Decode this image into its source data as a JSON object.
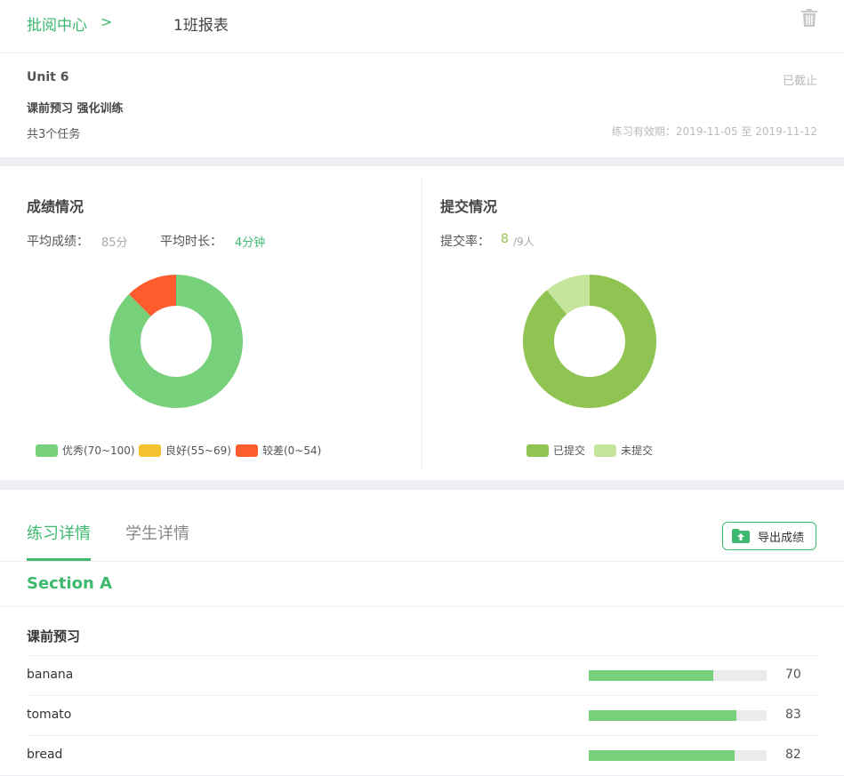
{
  "header": {
    "breadcrumb": "批阅中心",
    "separator": ">",
    "title": "1班报表"
  },
  "info": {
    "unit": "Unit 6",
    "status": "已截止",
    "task_name": "课前预习 强化训练",
    "task_count": "共3个任务",
    "validity": "练习有效期：2019-11-05 至 2019-11-12"
  },
  "scores": {
    "title": "成绩情况",
    "avg_score_label": "平均成绩：",
    "avg_score_value": "85分",
    "avg_time_label": "平均时长：",
    "avg_time_value": "4分钟"
  },
  "submission": {
    "title": "提交情况",
    "rate_label": "提交率：",
    "submitted": "8",
    "total": "/9人"
  },
  "colors": {
    "accent": "#3dba6f",
    "excellent": "#77d07a",
    "good": "#f4c430",
    "poor": "#ff5c2e",
    "submitted": "#8fc453",
    "not_submitted": "#c4e59b"
  },
  "chart_data": [
    {
      "type": "pie",
      "categories": [
        "优秀(70~100)",
        "良好(55~69)",
        "较差(0~54)"
      ],
      "values": [
        7,
        0,
        1
      ]
    },
    {
      "type": "pie",
      "categories": [
        "已提交",
        "未提交"
      ],
      "values": [
        8,
        1
      ]
    }
  ],
  "tabs": {
    "exercise": "练习详情",
    "student": "学生详情"
  },
  "export_label": "导出成绩",
  "section": {
    "title": "Section A",
    "group": "课前预习",
    "items": [
      {
        "name": "banana",
        "score": 70
      },
      {
        "name": "tomato",
        "score": 83
      },
      {
        "name": "bread",
        "score": 82
      }
    ]
  }
}
